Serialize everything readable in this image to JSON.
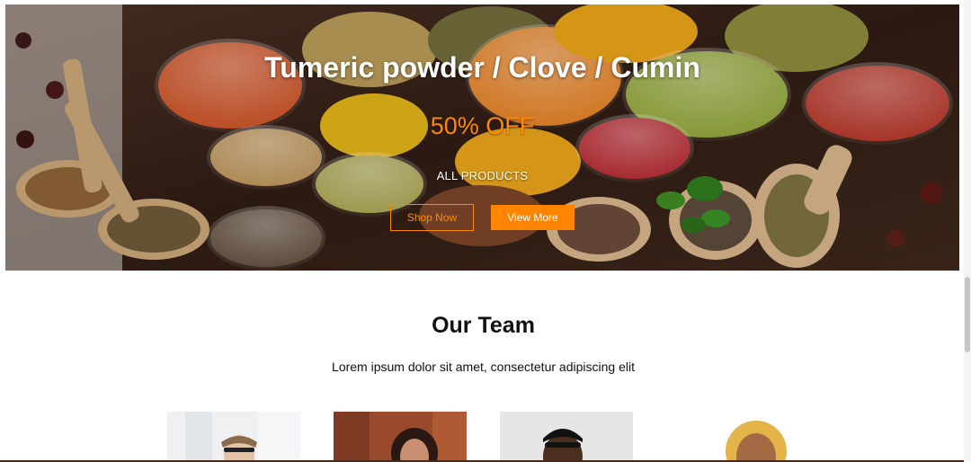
{
  "hero": {
    "title": "Tumeric powder / Clove / Cumin",
    "discount": "50% OFF",
    "subtitle": "ALL PRODUCTS",
    "shop_now_label": "Shop Now",
    "view_more_label": "View More",
    "accent_color": "#ff8a00"
  },
  "team": {
    "title": "Our Team",
    "description": "Lorem ipsum dolor sit amet, consectetur adipiscing elit",
    "members": [
      {
        "photo": "man-with-glasses-photo"
      },
      {
        "photo": "woman-smiling-photo"
      },
      {
        "photo": "man-with-glasses-grey-background-photo"
      },
      {
        "photo": "woman-curly-hair-photo"
      }
    ]
  }
}
